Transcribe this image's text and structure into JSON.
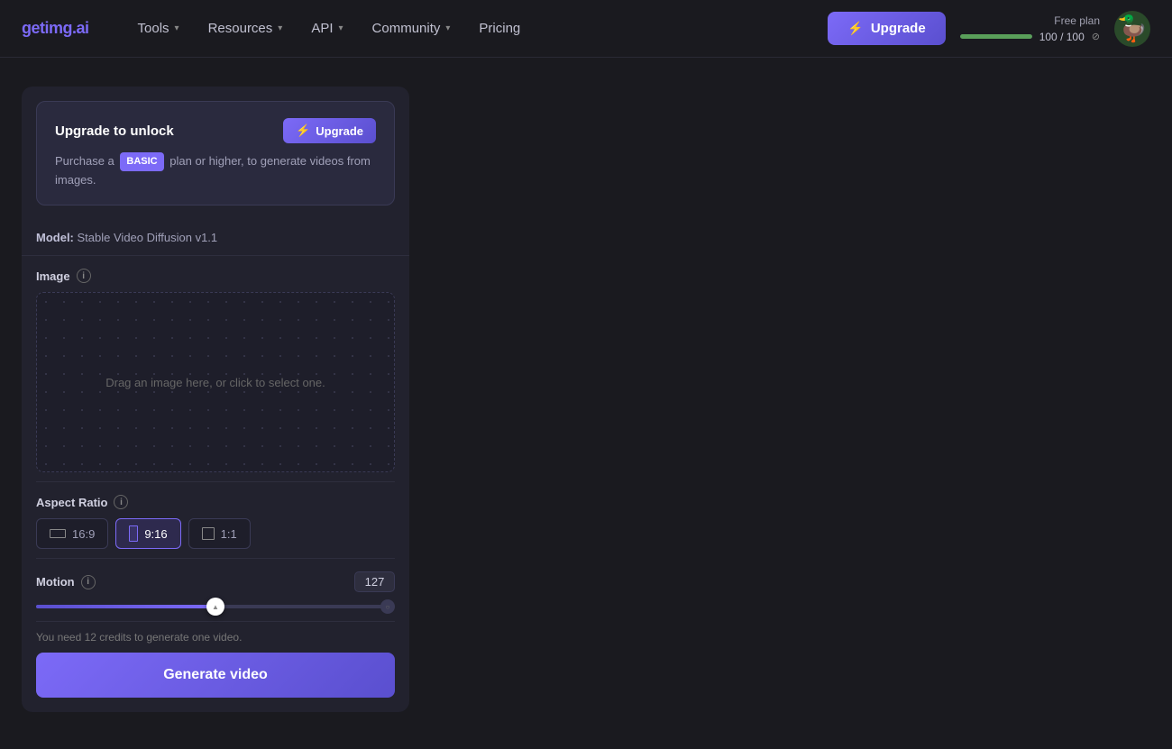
{
  "nav": {
    "logo": "getimg.ai",
    "items": [
      {
        "id": "tools",
        "label": "Tools",
        "has_dropdown": true
      },
      {
        "id": "resources",
        "label": "Resources",
        "has_dropdown": true
      },
      {
        "id": "api",
        "label": "API",
        "has_dropdown": true
      },
      {
        "id": "community",
        "label": "Community",
        "has_dropdown": true
      },
      {
        "id": "pricing",
        "label": "Pricing",
        "has_dropdown": false
      }
    ],
    "upgrade_button_label": "Upgrade",
    "plan_label": "Free plan",
    "plan_current": "100",
    "plan_separator": "/",
    "plan_total": "100",
    "plan_bar_percent": 100
  },
  "banner": {
    "title": "Upgrade to unlock",
    "upgrade_label": "Upgrade",
    "bolt_icon": "⚡",
    "text_before_badge": "Purchase a",
    "badge_label": "BASIC",
    "text_after_badge": "plan or higher, to generate videos from images."
  },
  "model_row": {
    "label": "Model:",
    "value": "Stable Video Diffusion v1.1"
  },
  "image_field": {
    "label": "Image",
    "info_icon": "i",
    "dropzone_text": "Drag an image here, or click to select one."
  },
  "aspect_ratio_field": {
    "label": "Aspect Ratio",
    "info_icon": "i",
    "options": [
      {
        "id": "16-9",
        "label": "16:9",
        "active": false
      },
      {
        "id": "9-16",
        "label": "9:16",
        "active": true
      },
      {
        "id": "1-1",
        "label": "1:1",
        "active": false
      }
    ]
  },
  "motion_field": {
    "label": "Motion",
    "info_icon": "i",
    "value": "127",
    "slider_percent": 50
  },
  "footer": {
    "credits_note": "You need 12 credits to generate one video.",
    "generate_button_label": "Generate video"
  }
}
